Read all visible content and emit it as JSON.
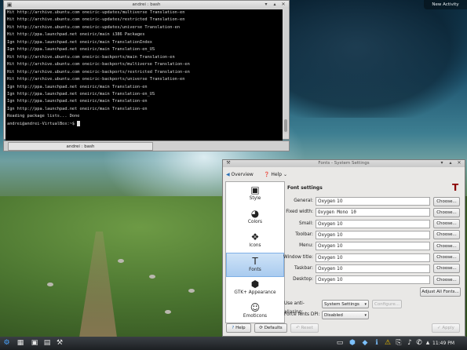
{
  "desktop": {
    "new_activity_label": "New Activity"
  },
  "terminal": {
    "title": "andrei : bash",
    "lines": [
      "Hit http://archive.ubuntu.com oneiric-updates/multiverse Translation-en",
      "Hit http://archive.ubuntu.com oneiric-updates/restricted Translation-en",
      "Hit http://archive.ubuntu.com oneiric-updates/universe Translation-en",
      "Hit http://ppa.launchpad.net oneiric/main i386 Packages",
      "Ign http://ppa.launchpad.net oneiric/main TranslationIndex",
      "Ign http://ppa.launchpad.net oneiric/main Translation-en_US",
      "Hit http://archive.ubuntu.com oneiric-backports/main Translation-en",
      "Hit http://archive.ubuntu.com oneiric-backports/multiverse Translation-en",
      "Hit http://archive.ubuntu.com oneiric-backports/restricted Translation-en",
      "Hit http://archive.ubuntu.com oneiric-backports/universe Translation-en",
      "Ign http://ppa.launchpad.net oneiric/main Translation-en",
      "Ign http://ppa.launchpad.net oneiric/main Translation-en_US",
      "Ign http://ppa.launchpad.net oneiric/main Translation-en",
      "Ign http://ppa.launchpad.net oneiric/main Translation-en",
      "Reading package lists... Done"
    ],
    "prompt": "andrei@andrei-VirtualBox:~$ ",
    "tab_label": "andrei : bash"
  },
  "settings": {
    "title": "Fonts - System Settings",
    "toolbar": {
      "overview_label": "Overview",
      "help_label": "Help"
    },
    "sidebar": [
      {
        "label": "Style",
        "icon": "style-icon",
        "glyph": "▣"
      },
      {
        "label": "Colors",
        "icon": "colors-icon",
        "glyph": "◕"
      },
      {
        "label": "Icons",
        "icon": "icons-icon",
        "glyph": "❖"
      },
      {
        "label": "Fonts",
        "icon": "fonts-icon",
        "glyph": "T",
        "selected": true
      },
      {
        "label": "GTK+ Appearance",
        "icon": "gtk-icon",
        "glyph": "⬢"
      },
      {
        "label": "Emoticons",
        "icon": "emoticons-icon",
        "glyph": "☺"
      }
    ],
    "section_title": "Font settings",
    "rows": [
      {
        "label": "General:",
        "value": "Oxygen 10"
      },
      {
        "label": "Fixed width:",
        "value": "Oxygen Mono 10"
      },
      {
        "label": "Small:",
        "value": "Oxygen 10"
      },
      {
        "label": "Toolbar:",
        "value": "Oxygen 10"
      },
      {
        "label": "Menu:",
        "value": "Oxygen 10"
      },
      {
        "label": "Window title:",
        "value": "Oxygen 10"
      },
      {
        "label": "Taskbar:",
        "value": "Oxygen 10"
      },
      {
        "label": "Desktop:",
        "value": "Oxygen 10"
      }
    ],
    "choose_label": "Choose...",
    "adjust_label": "Adjust All Fonts...",
    "antialias_label": "Use anti-aliasing:",
    "antialias_value": "System Settings",
    "configure_label": "Configure...",
    "dpi_label": "Force fonts DPI:",
    "dpi_value": "Disabled",
    "help_button": "Help",
    "defaults_button": "Defaults",
    "reset_button": "Reset",
    "apply_button": "Apply"
  },
  "panel": {
    "clock": "11:49 PM"
  }
}
